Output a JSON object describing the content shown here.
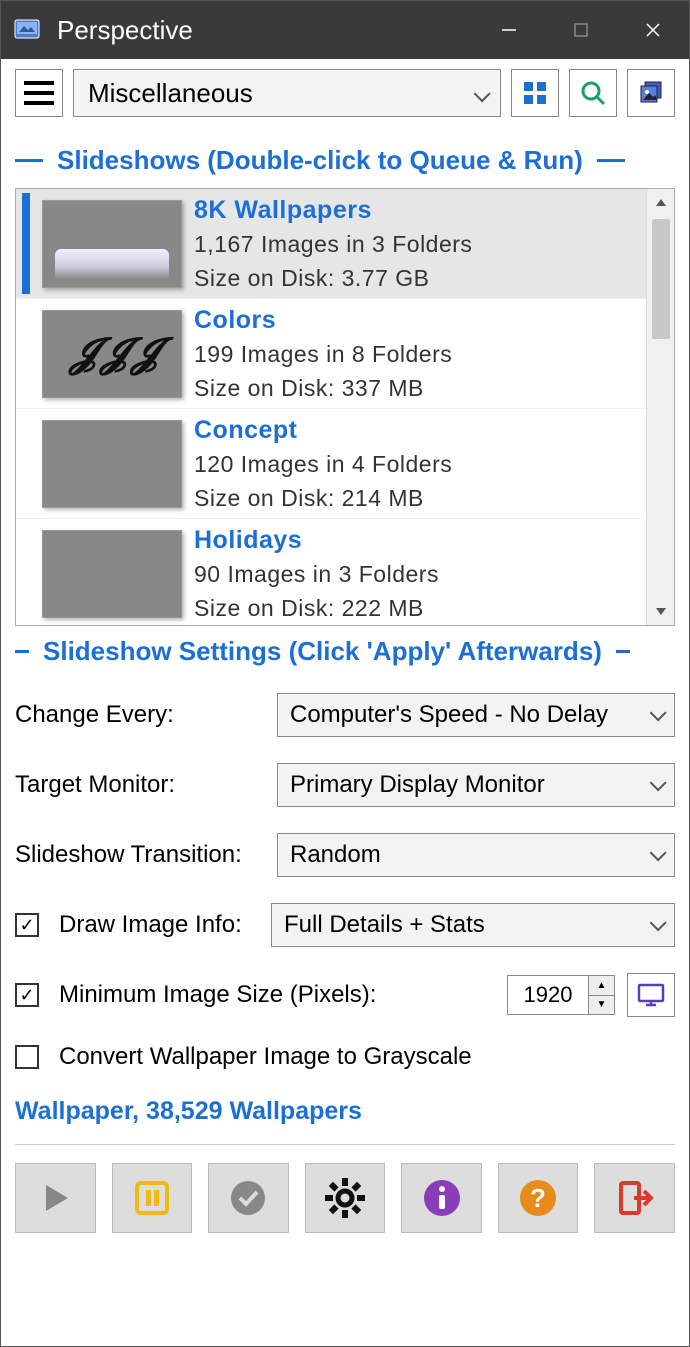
{
  "window": {
    "title": "Perspective"
  },
  "toolbar": {
    "category": "Miscellaneous"
  },
  "sections": {
    "slideshows_header": "Slideshows (Double-click to Queue & Run)",
    "settings_header": "Slideshow Settings (Click 'Apply' Afterwards)"
  },
  "slideshows": [
    {
      "name": "8K Wallpapers",
      "line1": "1,167 Images in 3 Folders",
      "line2": "Size on Disk: 3.77 GB",
      "selected": true,
      "thumbClass": "thumb-car"
    },
    {
      "name": "Colors",
      "line1": "199 Images in 8 Folders",
      "line2": "Size on Disk: 337 MB",
      "selected": false,
      "thumbClass": "thumb-colors"
    },
    {
      "name": "Concept",
      "line1": "120 Images in 4 Folders",
      "line2": "Size on Disk: 214 MB",
      "selected": false,
      "thumbClass": "thumb-concept"
    },
    {
      "name": "Holidays",
      "line1": "90 Images in 3 Folders",
      "line2": "Size on Disk: 222 MB",
      "selected": false,
      "thumbClass": "thumb-holidays"
    }
  ],
  "settings": {
    "change_every_label": "Change Every:",
    "change_every_value": "Computer's Speed - No Delay",
    "target_monitor_label": "Target Monitor:",
    "target_monitor_value": "Primary Display Monitor",
    "transition_label": "Slideshow Transition:",
    "transition_value": "Random",
    "draw_info_checked": true,
    "draw_info_label": "Draw Image Info:",
    "draw_info_value": "Full Details + Stats",
    "min_size_checked": true,
    "min_size_label": "Minimum Image Size (Pixels):",
    "min_size_value": "1920",
    "grayscale_checked": false,
    "grayscale_label": "Convert Wallpaper Image to Grayscale"
  },
  "status": {
    "text": "Wallpaper, 38,529 Wallpapers"
  },
  "colors": {
    "accent": "#1c6fd4",
    "pause": "#f2b90f",
    "info": "#8a3db8",
    "help": "#e78b1a",
    "exit": "#d83a2b"
  }
}
